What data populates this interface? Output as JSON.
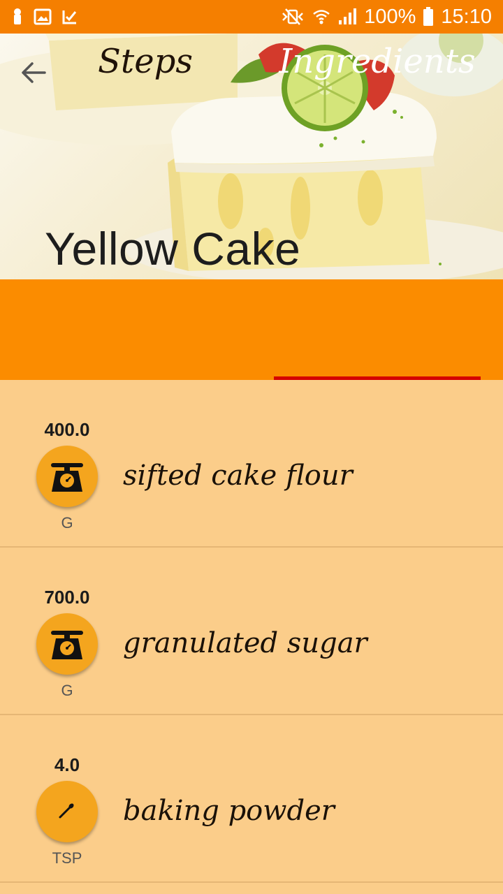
{
  "status_bar": {
    "battery": "100%",
    "time": "15:10",
    "left_icons": [
      "notification-icon",
      "gallery-icon",
      "app-notification-icon"
    ],
    "right_icons": [
      "mute-icon",
      "wifi-icon",
      "signal-icon",
      "battery-icon"
    ]
  },
  "header": {
    "title": "Yellow Cake",
    "back_icon": "arrow-left-icon"
  },
  "tabs": [
    {
      "label": "Steps",
      "selected": false
    },
    {
      "label": "Ingredients",
      "selected": true
    }
  ],
  "ingredients": [
    {
      "quantity": "400.0",
      "unit": "G",
      "name": "sifted cake flour",
      "icon": "scale-icon"
    },
    {
      "quantity": "700.0",
      "unit": "G",
      "name": "granulated sugar",
      "icon": "scale-icon"
    },
    {
      "quantity": "4.0",
      "unit": "TSP",
      "name": "baking powder",
      "icon": "spoon-icon"
    }
  ],
  "colors": {
    "status_bar": "#F57F00",
    "tab_bar": "#FB8C00",
    "list_background": "#FBCD8A",
    "tab_indicator": "#D50000",
    "unit_circle": "#F4A51E"
  }
}
